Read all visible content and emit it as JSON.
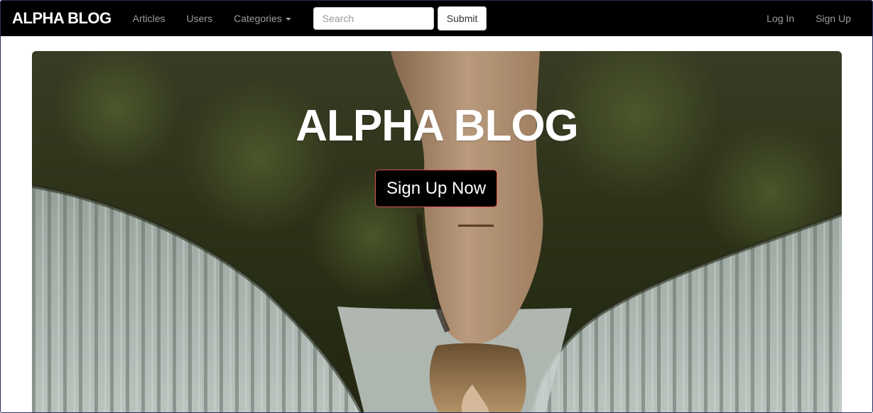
{
  "navbar": {
    "brand": "ALPHA BLOG",
    "links": {
      "articles": "Articles",
      "users": "Users",
      "categories": "Categories"
    },
    "search": {
      "placeholder": "Search",
      "value": ""
    },
    "submit_label": "Submit",
    "login": "Log In",
    "signup": "Sign Up"
  },
  "hero": {
    "title": "ALPHA BLOG",
    "cta_label": "Sign Up Now"
  },
  "colors": {
    "navbar_bg": "#000000",
    "nav_link": "#9d9d9d",
    "cta_bg": "#000000",
    "cta_border": "#d9534f"
  }
}
